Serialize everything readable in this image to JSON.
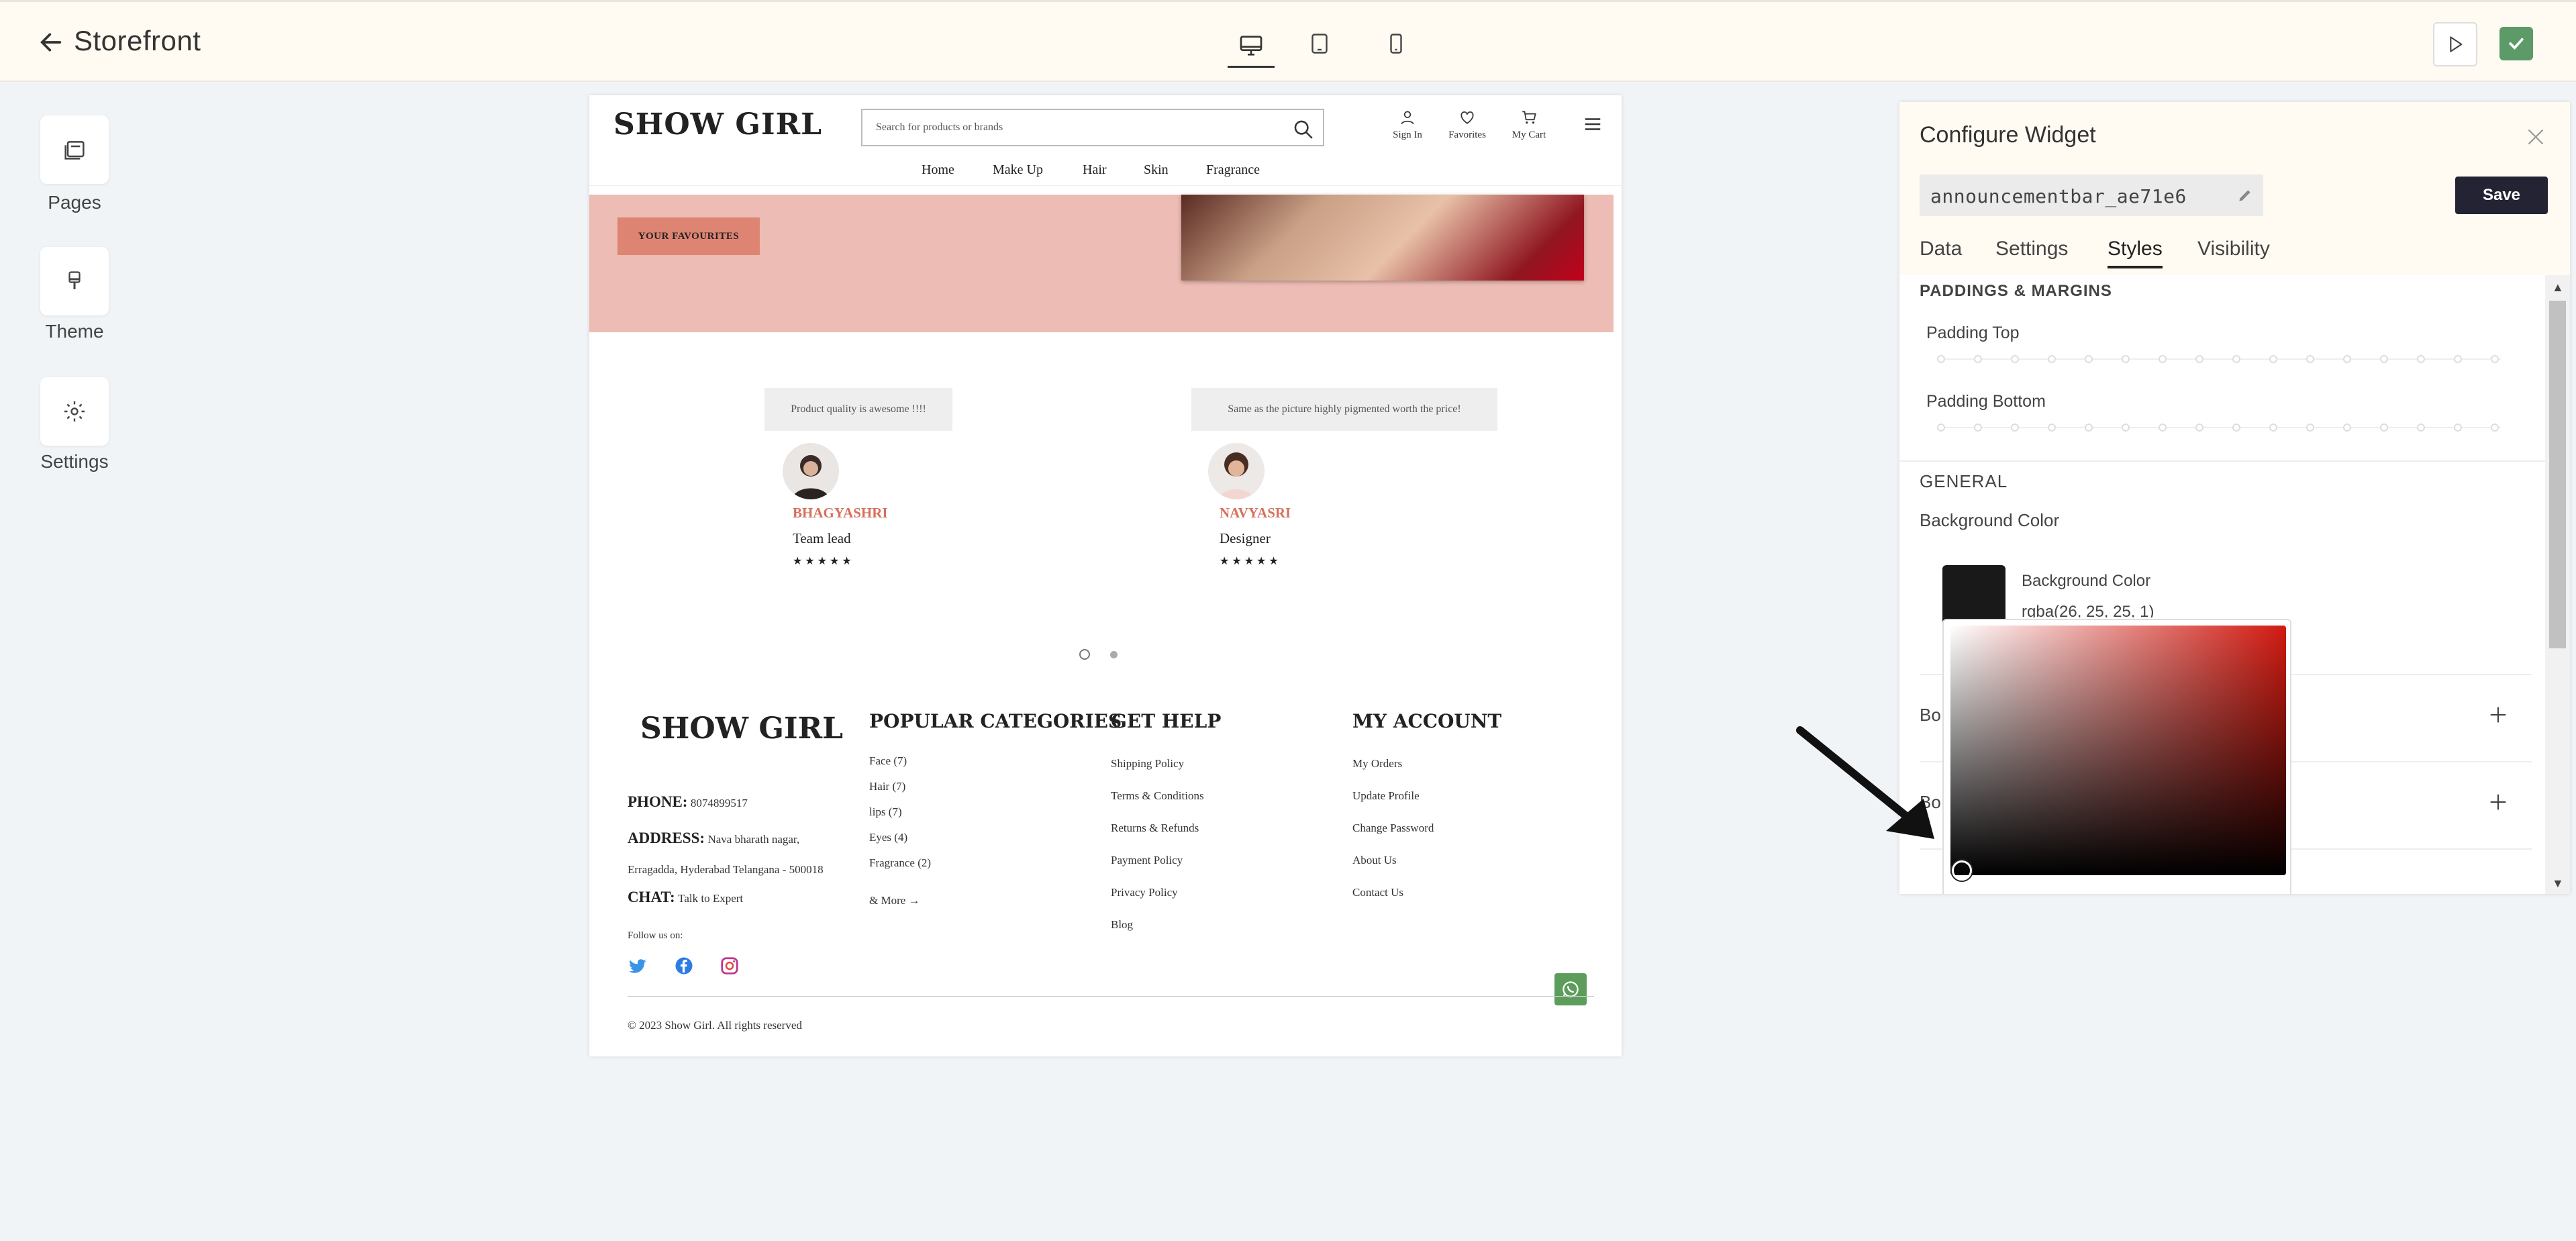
{
  "app": {
    "title": "Storefront"
  },
  "rail": [
    {
      "label": "Pages",
      "icon": "pages-icon"
    },
    {
      "label": "Theme",
      "icon": "brush-icon"
    },
    {
      "label": "Settings",
      "icon": "gear-icon"
    }
  ],
  "store": {
    "logo": "SHOW GIRL",
    "search_placeholder": "Search for products or brands",
    "header_icons": [
      {
        "label": "Sign In",
        "icon": "user-icon"
      },
      {
        "label": "Favorites",
        "icon": "heart-icon"
      },
      {
        "label": "My Cart",
        "icon": "cart-icon"
      }
    ],
    "nav": [
      "Home",
      "Make Up",
      "Hair",
      "Skin",
      "Fragrance"
    ],
    "hero_button": "YOUR FAVOURITES",
    "reviews": [
      {
        "quote": "Product quality is awesome !!!!",
        "name": "BHAGYASHRI",
        "role": "Team lead",
        "stars": "★★★★★"
      },
      {
        "quote": "Same as the picture highly pigmented worth the price!",
        "name": "NAVYASRI",
        "role": "Designer",
        "stars": "★★★★★"
      }
    ],
    "footer": {
      "logo": "SHOW GIRL",
      "phone_label": "PHONE:",
      "phone": "8074899517",
      "address_label": "ADDRESS:",
      "address_line1": "Nava bharath nagar,",
      "address_line2": "Erragadda, Hyderabad Telangana - 500018",
      "chat_label": "CHAT:",
      "chat": "Talk to Expert",
      "follow": "Follow us on:",
      "popular_title": "POPULAR CATEGORIES",
      "popular": [
        "Face (7)",
        "Hair (7)",
        "lips (7)",
        "Eyes (4)",
        "Fragrance (2)"
      ],
      "more": "& More",
      "help_title": "GET HELP",
      "help": [
        "Shipping Policy",
        "Terms & Conditions",
        "Returns & Refunds",
        "Payment Policy",
        "Privacy Policy",
        "Blog"
      ],
      "account_title": "MY ACCOUNT",
      "account": [
        "My Orders",
        "Update Profile",
        "Change Password",
        "About Us",
        "Contact Us"
      ],
      "copyright": "© 2023 Show Girl. All rights reserved"
    }
  },
  "panel": {
    "title": "Configure Widget",
    "widget_name": "announcementbar_ae71e6",
    "save": "Save",
    "tabs": [
      "Data",
      "Settings",
      "Styles",
      "Visibility"
    ],
    "active_tab": "Styles",
    "section_padding": "PADDINGS & MARGINS",
    "padding_top": "Padding Top",
    "padding_bottom": "Padding Bottom",
    "section_general": "GENERAL",
    "bg_color_label": "Background Color",
    "bg_color_sub": "Background Color",
    "bg_color_value": "rgba(26, 25, 25, 1)",
    "row1_label": "Bo",
    "row2_label": "Bo"
  },
  "colors": {
    "accent": "#232334",
    "swatch": "#1a1919",
    "success": "#5c9a68",
    "hue": "#d11a11",
    "review_name": "#d6705c"
  }
}
